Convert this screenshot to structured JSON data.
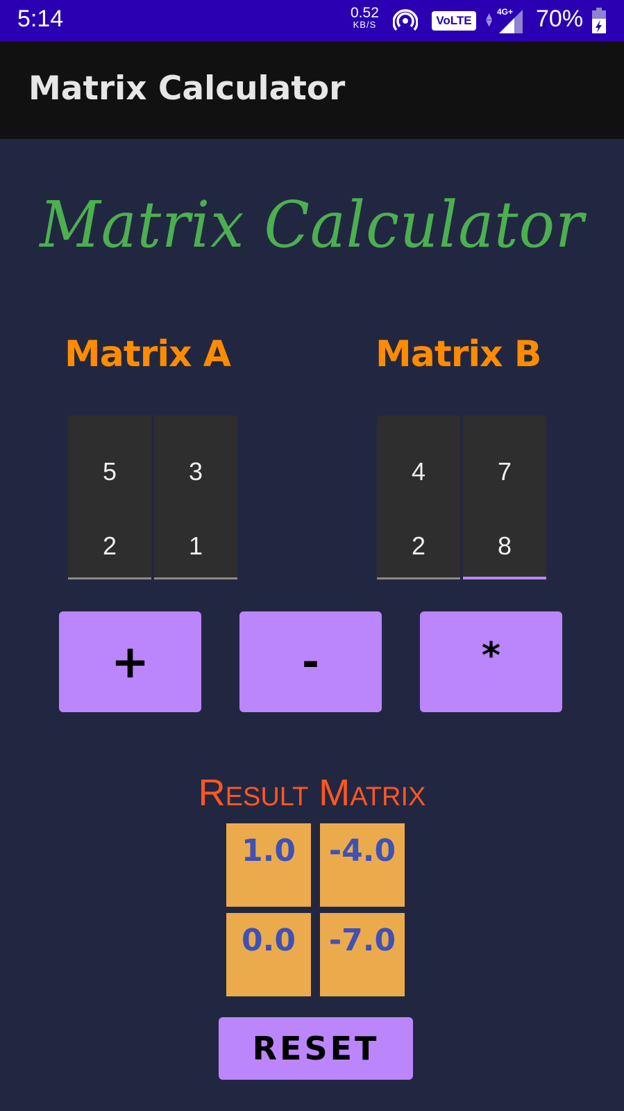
{
  "status_bar": {
    "time": "5:14",
    "net_speed_value": "0.52",
    "net_speed_unit": "KB/S",
    "hotspot_icon": "hotspot-icon",
    "volte_label": "VoLTE",
    "network_type": "4G+",
    "signal_icon": "signal-icon",
    "battery_percent": "70%",
    "battery_icon": "battery-charging-icon"
  },
  "app_bar": {
    "title": "Matrix Calculator"
  },
  "hero": {
    "title": "Matrix Calculator"
  },
  "matrix_a": {
    "label": "Matrix A",
    "values": [
      [
        "5",
        "3"
      ],
      [
        "2",
        "1"
      ]
    ]
  },
  "matrix_b": {
    "label": "Matrix B",
    "values": [
      [
        "4",
        "7"
      ],
      [
        "2",
        "8"
      ]
    ]
  },
  "operations": {
    "add": "+",
    "subtract": "-",
    "multiply": "*"
  },
  "result": {
    "title": "Result Matrix",
    "values": [
      [
        "1.0",
        "-4.0"
      ],
      [
        "0.0",
        "-7.0"
      ]
    ]
  },
  "reset_label": "RESET",
  "colors": {
    "status_bar": "#2a00b2",
    "app_bar": "#111111",
    "background": "#222741",
    "hero_green": "#4caf50",
    "label_orange": "#ff8c00",
    "result_title": "#ff5722",
    "button_purple": "#bb86fc",
    "result_cell": "#ebab4c",
    "result_text": "#3f51b5"
  }
}
